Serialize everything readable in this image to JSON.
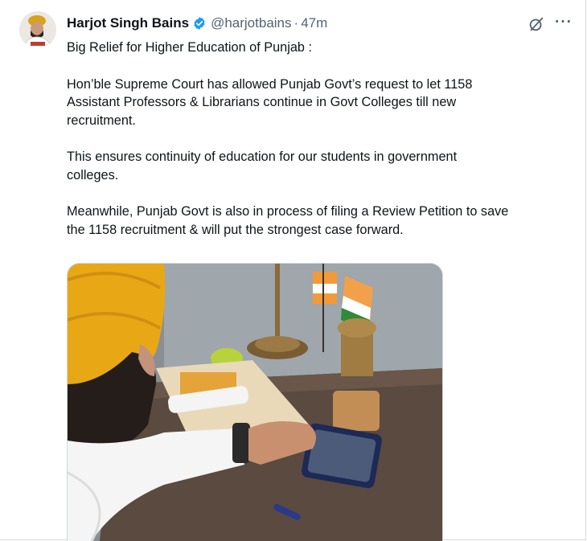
{
  "tweet": {
    "author_name": "Harjot Singh Bains",
    "handle": "@harjotbains",
    "separator": "·",
    "time": "47m",
    "verified": true,
    "paragraphs": [
      "Big Relief for Higher Education of Punjab :",
      "Hon’ble Supreme Court has allowed Punjab Govt’s request to let 1158\nAssistant Professors & Librarians continue in Govt Colleges till new\nrecruitment.",
      "This ensures continuity of education for our students in government\ncolleges.",
      "Meanwhile, Punjab Govt is also in process of filing a Review Petition to save\nthe 1158 recruitment & will put the strongest case forward."
    ]
  },
  "icons": {
    "verified": "verified-badge-icon",
    "grok": "grok-icon",
    "more": "more-options-icon"
  },
  "colors": {
    "verified_blue": "#1d9bf0",
    "secondary_text": "#536471",
    "primary_text": "#0f1419"
  },
  "more_glyph": "···"
}
